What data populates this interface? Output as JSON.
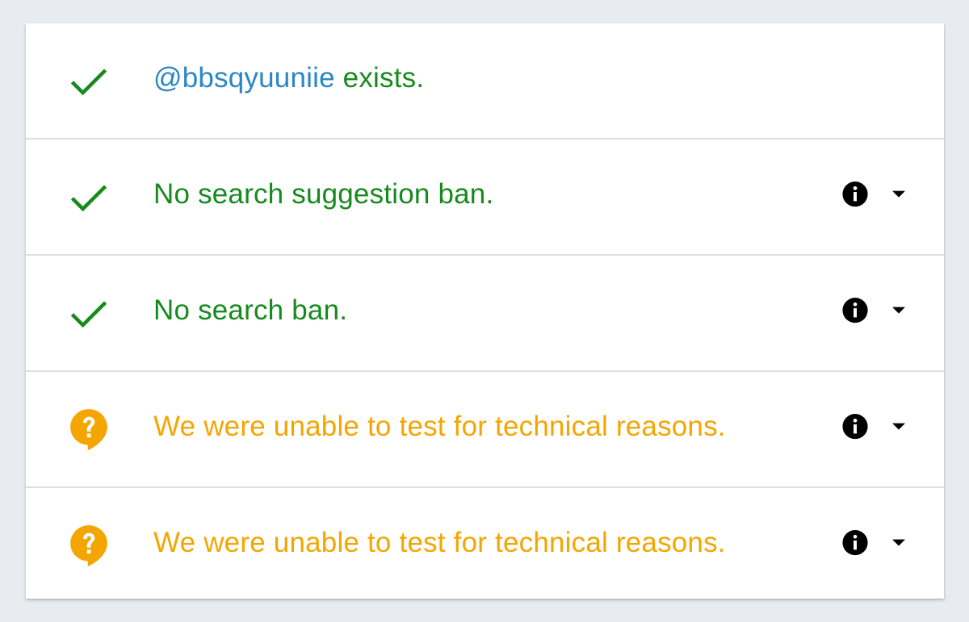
{
  "colors": {
    "success": "#178a1d",
    "warning": "#f5a500",
    "link": "#2a86c7",
    "icon": "#000000",
    "background": "#e8ecf0",
    "card": "#ffffff",
    "divider": "#dcdfe2"
  },
  "rows": [
    {
      "status": "success",
      "status_icon": "checkmark-icon",
      "handle": "@bbsqyuuniie",
      "text": " exists.",
      "has_controls": false
    },
    {
      "status": "success",
      "status_icon": "checkmark-icon",
      "text": "No search suggestion ban.",
      "has_controls": true,
      "info_icon": "info-icon",
      "expand_icon": "caret-down-icon"
    },
    {
      "status": "success",
      "status_icon": "checkmark-icon",
      "text": "No search ban.",
      "has_controls": true,
      "info_icon": "info-icon",
      "expand_icon": "caret-down-icon"
    },
    {
      "status": "warning",
      "status_icon": "question-bubble-icon",
      "text": "We were unable to test for technical reasons.",
      "has_controls": true,
      "info_icon": "info-icon",
      "expand_icon": "caret-down-icon"
    },
    {
      "status": "warning",
      "status_icon": "question-bubble-icon",
      "text": "We were unable to test for technical reasons.",
      "has_controls": true,
      "info_icon": "info-icon",
      "expand_icon": "caret-down-icon"
    }
  ]
}
